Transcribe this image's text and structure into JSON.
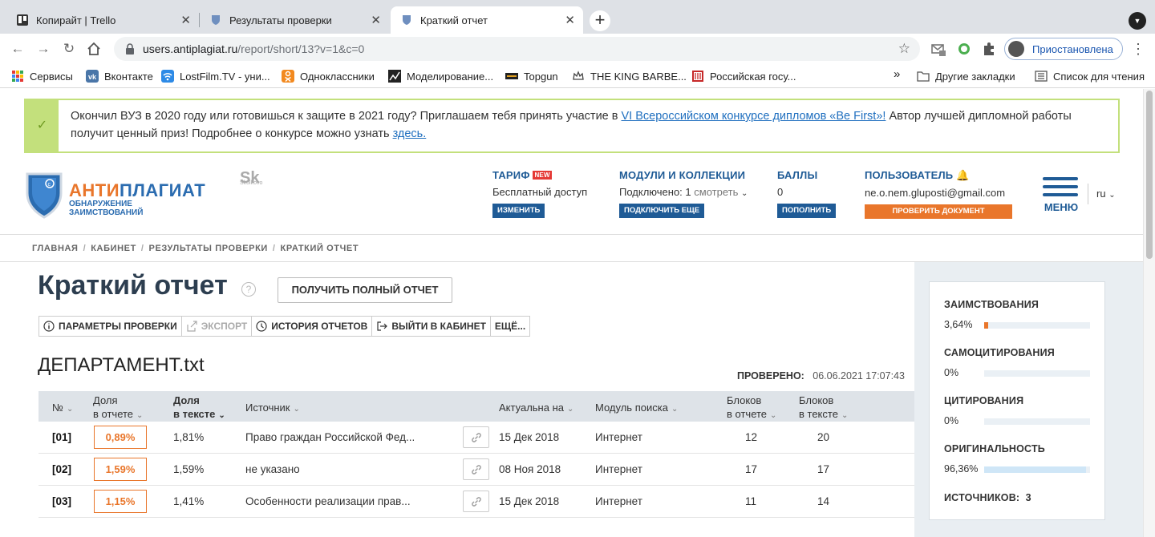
{
  "browser": {
    "tabs": [
      {
        "title": "Копирайт | Trello",
        "icon": "trello-icon"
      },
      {
        "title": "Результаты проверки",
        "icon": "antiplagiat-shield-icon"
      },
      {
        "title": "Краткий отчет",
        "icon": "antiplagiat-shield-icon",
        "active": true
      }
    ],
    "url_host": "users.antiplagiat.ru",
    "url_path": "/report/short/13?v=1&c=0",
    "profile_label": "Приостановлена",
    "bookmarks": [
      {
        "label": "Сервисы",
        "icon": "apps-grid-icon"
      },
      {
        "label": "Вконтакте",
        "icon": "vk-icon"
      },
      {
        "label": "LostFilm.TV - уни...",
        "icon": "wifi-icon"
      },
      {
        "label": "Одноклассники",
        "icon": "ok-icon"
      },
      {
        "label": "Моделирование...",
        "icon": "chart-icon"
      },
      {
        "label": "Topgun",
        "icon": "topgun-icon"
      },
      {
        "label": "THE KING BARBE...",
        "icon": "crown-icon"
      },
      {
        "label": "Российская госу...",
        "icon": "book-icon"
      }
    ],
    "more_bookmarks": "»",
    "other_bookmarks": "Другие закладки",
    "reading_list": "Список для чтения"
  },
  "banner": {
    "text_before": "Окончил ВУЗ в 2020 году или готовишься к защите в 2021 году? Приглашаем тебя принять участие в ",
    "link1": "VI Всероссийском конкурсе дипломов «Be First»!",
    "text_middle": " Автор лучшей дипломной работы получит ценный приз! Подробнее о конкурсе можно узнать ",
    "link2": "здесь."
  },
  "header": {
    "logo_word_a": "АНТИ",
    "logo_word_b": "ПЛАГИАТ",
    "logo_sub": "ОБНАРУЖЕНИЕ ЗАИМСТВОВАНИЙ",
    "skolkovo": "Sk",
    "skolkovo_sub": "Skolkovo",
    "tariff": {
      "title": "ТАРИФ",
      "badge": "NEW",
      "value": "Бесплатный доступ",
      "button": "ИЗМЕНИТЬ"
    },
    "modules": {
      "title": "МОДУЛИ И КОЛЛЕКЦИИ",
      "value_prefix": "Подключено: 1",
      "value_link": "смотреть",
      "button": "ПОДКЛЮЧИТЬ ЕЩЕ"
    },
    "points": {
      "title": "БАЛЛЫ",
      "value": "0",
      "button": "ПОПОЛНИТЬ"
    },
    "user": {
      "title": "ПОЛЬЗОВАТЕЛЬ",
      "email": "ne.o.nem.gluposti@gmail.com",
      "button": "ПРОВЕРИТЬ ДОКУМЕНТ"
    },
    "menu_label": "МЕНЮ",
    "lang": "ru"
  },
  "breadcrumbs": [
    "ГЛАВНАЯ",
    "КАБИНЕТ",
    "РЕЗУЛЬТАТЫ ПРОВЕРКИ",
    "КРАТКИЙ ОТЧЕТ"
  ],
  "report": {
    "title": "Краткий отчет",
    "full_report_button": "ПОЛУЧИТЬ ПОЛНЫЙ ОТЧЕТ",
    "actions": [
      "ПАРАМЕТРЫ ПРОВЕРКИ",
      "ЭКСПОРТ",
      "ИСТОРИЯ ОТЧЕТОВ",
      "ВЫЙТИ В КАБИНЕТ",
      "ЕЩЁ..."
    ],
    "document_name": "ДЕПАРТАМЕНТ.txt",
    "checked_label": "ПРОВЕРЕНО:",
    "checked_value": "06.06.2021 17:07:43"
  },
  "table": {
    "columns": {
      "num": "№",
      "share_report_1": "Доля",
      "share_report_2": "в отчете",
      "share_text_1": "Доля",
      "share_text_2": "в тексте",
      "source": "Источник",
      "actual": "Актуальна на",
      "module": "Модуль поиска",
      "blocks_report_1": "Блоков",
      "blocks_report_2": "в отчете",
      "blocks_text_1": "Блоков",
      "blocks_text_2": "в тексте"
    },
    "rows": [
      {
        "num": "[01]",
        "share_report": "0,89%",
        "share_text": "1,81%",
        "source": "Право граждан Российской Фед...",
        "actual": "15 Дек 2018",
        "module": "Интернет",
        "blocks_report": "12",
        "blocks_text": "20"
      },
      {
        "num": "[02]",
        "share_report": "1,59%",
        "share_text": "1,59%",
        "source": "не указано",
        "actual": "08 Ноя 2018",
        "module": "Интернет",
        "blocks_report": "17",
        "blocks_text": "17"
      },
      {
        "num": "[03]",
        "share_report": "1,15%",
        "share_text": "1,41%",
        "source": "Особенности реализации прав...",
        "actual": "15 Дек 2018",
        "module": "Интернет",
        "blocks_report": "11",
        "blocks_text": "14"
      }
    ]
  },
  "summary": {
    "metrics": [
      {
        "label": "ЗАИМСТВОВАНИЯ",
        "value": "3,64%",
        "fraction": 0.0364,
        "color": "#e9762b"
      },
      {
        "label": "САМОЦИТИРОВАНИЯ",
        "value": "0%",
        "fraction": 0,
        "color": "#f2c744"
      },
      {
        "label": "ЦИТИРОВАНИЯ",
        "value": "0%",
        "fraction": 0,
        "color": "#4caf50"
      },
      {
        "label": "ОРИГИНАЛЬНОСТЬ",
        "value": "96,36%",
        "fraction": 0.9636,
        "color": "#cfe6f7"
      }
    ],
    "sources_label": "ИСТОЧНИКОВ:",
    "sources_value": "3"
  }
}
